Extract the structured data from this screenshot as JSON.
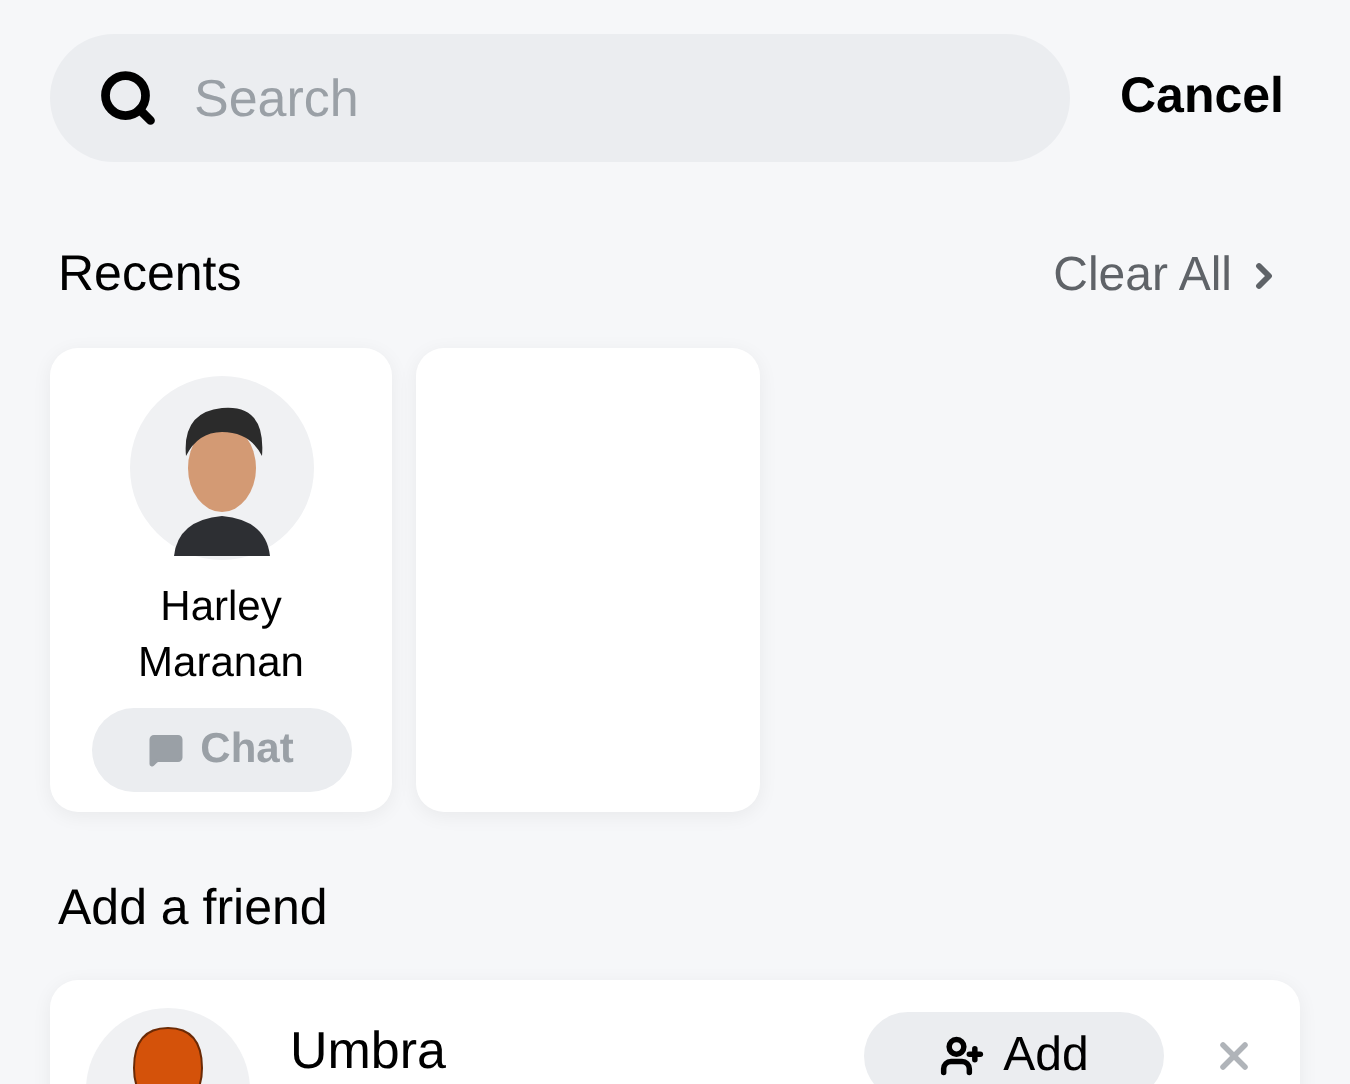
{
  "search": {
    "placeholder": "Search",
    "cancel": "Cancel"
  },
  "recents": {
    "title": "Recents",
    "clear": "Clear All",
    "items": [
      {
        "kind": "person",
        "name": "Harley Maranan",
        "action": "Chat"
      },
      {
        "kind": "empty"
      }
    ]
  },
  "add_friend": {
    "title": "Add a friend",
    "items": [
      {
        "name": "Umbra",
        "action": "Add"
      }
    ]
  }
}
